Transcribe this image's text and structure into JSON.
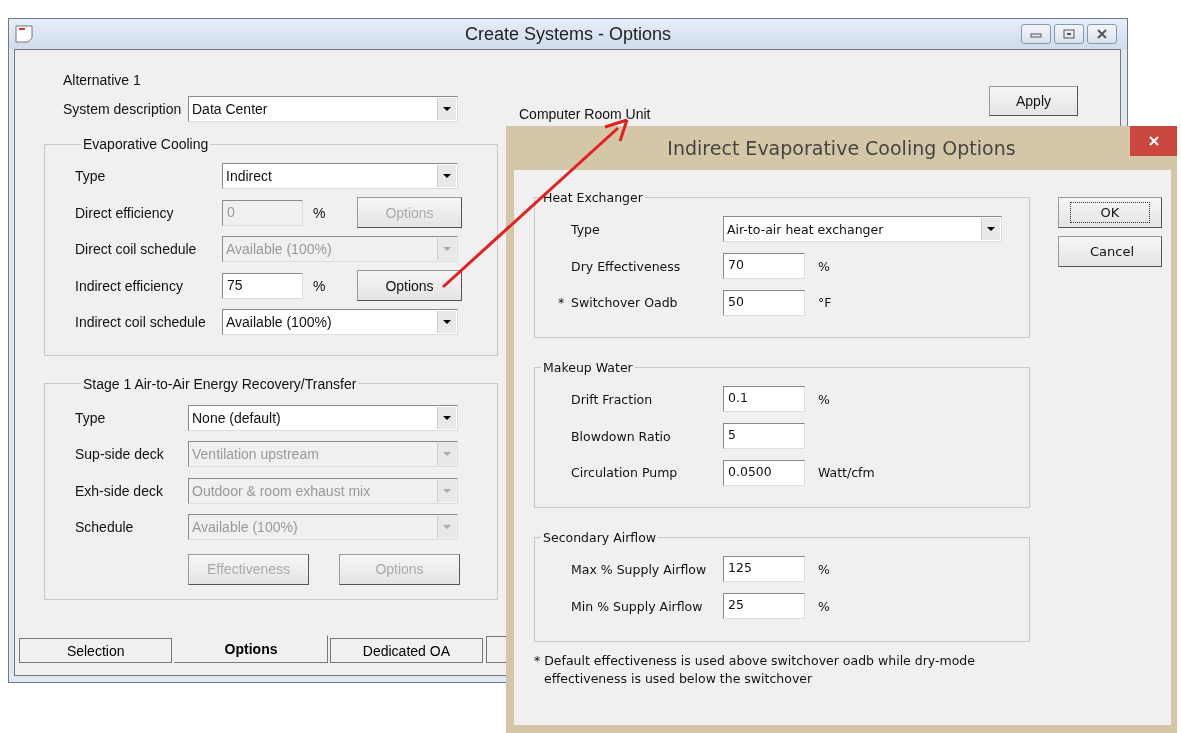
{
  "main_window": {
    "title": "Create Systems - Options",
    "alternative": "Alternative 1",
    "system_description": {
      "label": "System description",
      "value": "Data Center"
    },
    "unit_label": "Computer Room Unit",
    "apply_button": "Apply",
    "evaporative_cooling": {
      "title": "Evaporative Cooling",
      "rows": [
        {
          "kind": "combo",
          "label": "Type",
          "value": "Indirect",
          "disabled": false
        },
        {
          "kind": "efficiency",
          "label": "Direct efficiency",
          "value": "0",
          "unit": "%",
          "button": "Options",
          "disabled": true
        },
        {
          "kind": "combo",
          "label": "Direct coil schedule",
          "value": "Available (100%)",
          "disabled": true
        },
        {
          "kind": "efficiency",
          "label": "Indirect efficiency",
          "value": "75",
          "unit": "%",
          "button": "Options",
          "disabled": false
        },
        {
          "kind": "combo",
          "label": "Indirect coil schedule",
          "value": "Available (100%)",
          "disabled": false
        }
      ]
    },
    "energy_recovery": {
      "title": "Stage 1 Air-to-Air Energy Recovery/Transfer",
      "rows": [
        {
          "label": "Type",
          "value": "None (default)",
          "disabled": false
        },
        {
          "label": "Sup-side deck",
          "value": "Ventilation upstream",
          "disabled": true
        },
        {
          "label": "Exh-side deck",
          "value": "Outdoor & room exhaust mix",
          "disabled": true
        },
        {
          "label": "Schedule",
          "value": "Available (100%)",
          "disabled": true
        }
      ],
      "buttons": [
        {
          "label": "Effectiveness",
          "disabled": true
        },
        {
          "label": "Options",
          "disabled": true
        }
      ]
    },
    "tabs": [
      {
        "label": "Selection",
        "selected": false
      },
      {
        "label": "Options",
        "selected": true
      },
      {
        "label": "Dedicated OA",
        "selected": false
      }
    ]
  },
  "dialog": {
    "title": "Indirect Evaporative Cooling Options",
    "groups": [
      {
        "title": "Heat Exchanger",
        "rows": [
          {
            "kind": "combo",
            "label": "Type",
            "value": "Air-to-air heat exchanger"
          },
          {
            "kind": "field",
            "label": "Dry Effectiveness",
            "value": "70",
            "unit": "%"
          },
          {
            "kind": "field",
            "marker": "*",
            "label": "Switchover Oadb",
            "value": "50",
            "unit": "°F"
          }
        ]
      },
      {
        "title": "Makeup Water",
        "rows": [
          {
            "kind": "field",
            "label": "Drift Fraction",
            "value": "0.1",
            "unit": "%"
          },
          {
            "kind": "field",
            "label": "Blowdown Ratio",
            "value": "5"
          },
          {
            "kind": "field",
            "label": "Circulation Pump",
            "value": "0.0500",
            "unit": "Watt/cfm"
          }
        ]
      },
      {
        "title": "Secondary Airflow",
        "rows": [
          {
            "kind": "field",
            "label": "Max % Supply Airflow",
            "value": "125",
            "unit": "%"
          },
          {
            "kind": "field",
            "label": "Min % Supply Airflow",
            "value": "25",
            "unit": "%"
          }
        ]
      }
    ],
    "footnote": "* Default effectiveness is used above switchover oadb while dry-mode effectiveness is used below the switchover",
    "buttons": [
      {
        "label": "OK",
        "focused": true
      },
      {
        "label": "Cancel",
        "focused": false
      }
    ]
  }
}
